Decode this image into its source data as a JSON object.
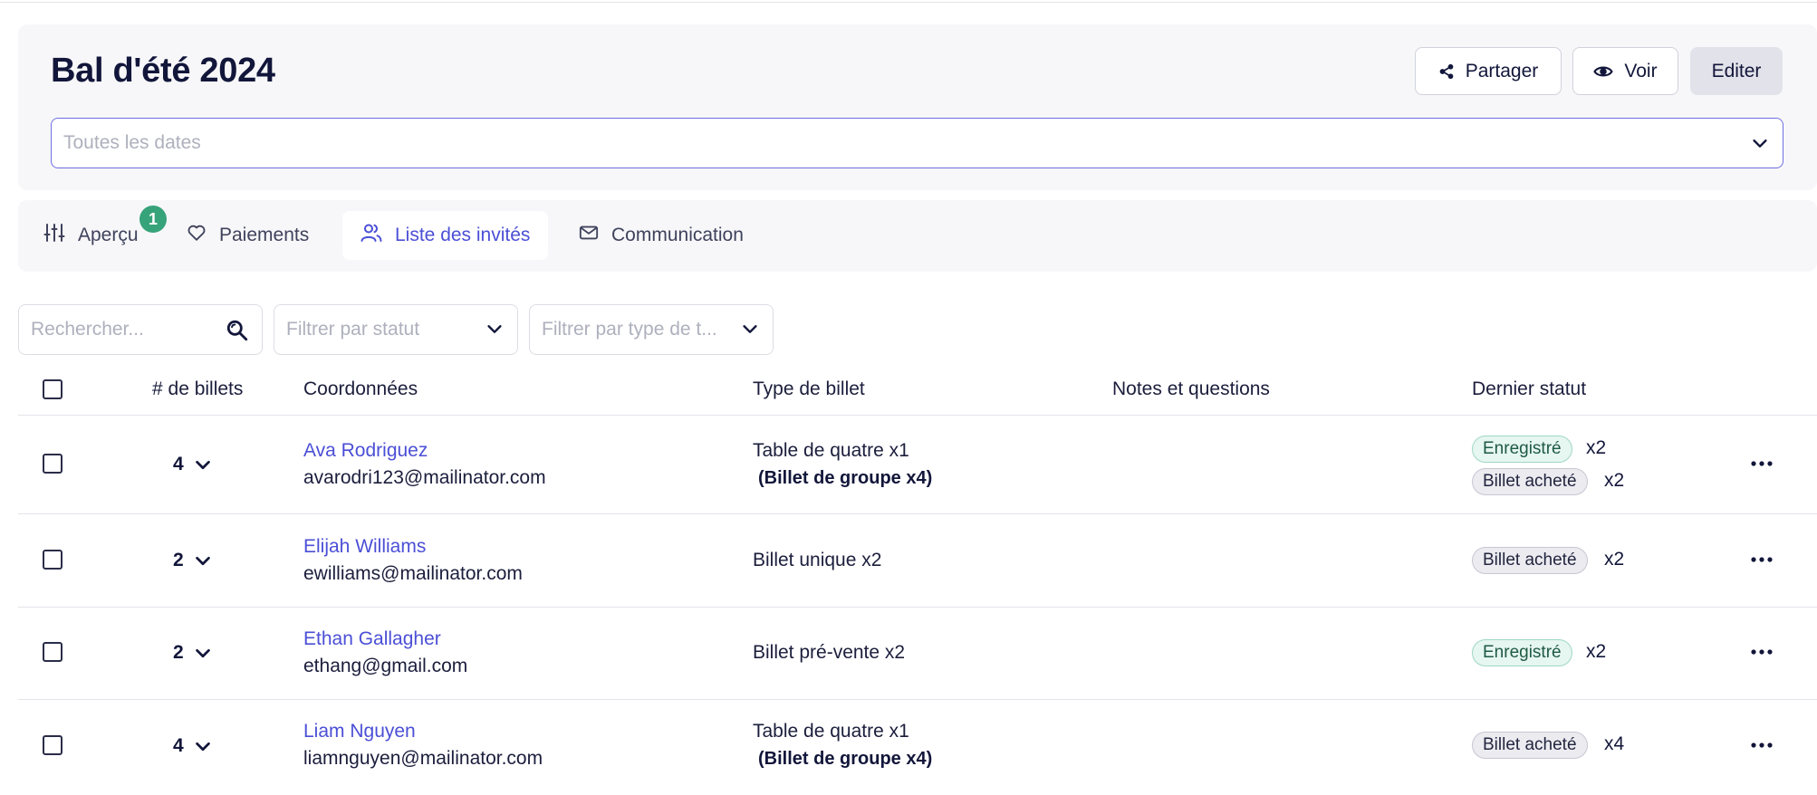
{
  "header": {
    "title": "Bal d'été 2024",
    "share_label": "Partager",
    "view_label": "Voir",
    "edit_label": "Editer",
    "date_placeholder": "Toutes les dates"
  },
  "tabs": [
    {
      "label": "Aperçu",
      "icon": "sliders-icon",
      "badge": "1"
    },
    {
      "label": "Paiements",
      "icon": "heart-icon"
    },
    {
      "label": "Liste des invités",
      "icon": "users-icon",
      "active": true
    },
    {
      "label": "Communication",
      "icon": "mail-icon"
    }
  ],
  "filters": {
    "search_placeholder": "Rechercher...",
    "status_placeholder": "Filtrer par statut",
    "type_placeholder": "Filtrer par type de t..."
  },
  "table": {
    "columns": [
      "# de billets",
      "Coordonnées",
      "Type de billet",
      "Notes et questions",
      "Dernier statut"
    ],
    "rows": [
      {
        "count": "4",
        "name": "Ava Rodriguez",
        "email": "avarodri123@mailinator.com",
        "ticket": "Table de quatre x1",
        "ticket_sub": "(Billet de groupe x4)",
        "statuses": [
          {
            "label": "Enregistré",
            "mult": "x2",
            "kind": "green"
          },
          {
            "label": "Billet acheté",
            "mult": "x2",
            "kind": "gray"
          }
        ]
      },
      {
        "count": "2",
        "name": "Elijah Williams",
        "email": "ewilliams@mailinator.com",
        "ticket": "Billet unique x2",
        "statuses": [
          {
            "label": "Billet acheté",
            "mult": "x2",
            "kind": "gray"
          }
        ]
      },
      {
        "count": "2",
        "name": "Ethan Gallagher",
        "email": "ethang@gmail.com",
        "ticket": "Billet pré-vente x2",
        "statuses": [
          {
            "label": "Enregistré",
            "mult": "x2",
            "kind": "green"
          }
        ]
      },
      {
        "count": "4",
        "name": "Liam Nguyen",
        "email": "liamnguyen@mailinator.com",
        "ticket": "Table de quatre x1",
        "ticket_sub": "(Billet de groupe x4)",
        "statuses": [
          {
            "label": "Billet acheté",
            "mult": "x4",
            "kind": "gray"
          }
        ]
      }
    ]
  },
  "colors": {
    "accent": "#4b4fd6",
    "badge_green": "#37a37a",
    "title": "#12163a"
  }
}
